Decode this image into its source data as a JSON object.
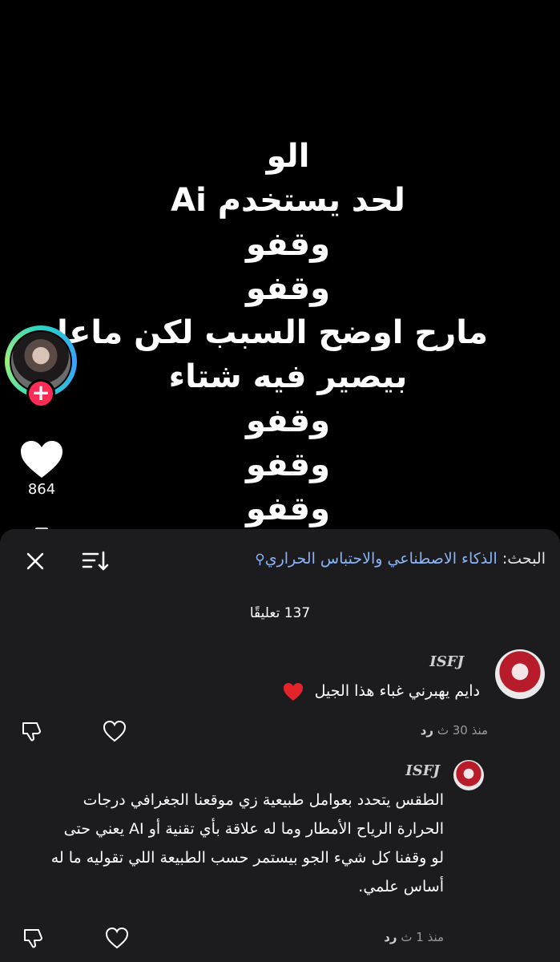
{
  "video": {
    "overlay_lines": [
      "الو",
      "لحد يستخدم Ai",
      "وقفو",
      "وقفو",
      "مارح اوضح السبب لكن ماعاد",
      "بيصير فيه شتاء",
      "وقفو",
      "وقفو",
      "وقفو"
    ],
    "like_count": "864",
    "follow_symbol": "+"
  },
  "comments_sheet": {
    "search_label": "البحث:",
    "search_term": "الذكاء الاصطناعي والاحتباس الحراري",
    "search_glyph": "⚲",
    "comment_count": "137 تعليقًا",
    "comments": [
      {
        "author": "ISFJ",
        "text": "دايم يهبرني غباء هذا الجيل",
        "time": "منذ 30 ث",
        "reply_label": "رد"
      },
      {
        "author": "ISFJ",
        "text_lines": [
          "الطقس يتحدد بعوامل طبيعية زي موقعنا الجغرافي درجات",
          "الحرارة الرياح الأمطار وما له علاقة بأي تقنية أو AI يعني حتى",
          "لو وقفنا كل شيء الجو بيستمر حسب الطبيعة اللي تقوليه ما له",
          "أساس علمي."
        ],
        "time": "منذ 1 ث",
        "reply_label": "رد"
      }
    ]
  },
  "colors": {
    "accent_red": "#fe2c55",
    "link_blue": "#8ab4f8",
    "sheet_bg": "#1c1c1f"
  },
  "icons": [
    "close-icon",
    "sort-icon",
    "search-icon",
    "dislike-icon",
    "like-heart-icon",
    "red-heart-emoji"
  ]
}
